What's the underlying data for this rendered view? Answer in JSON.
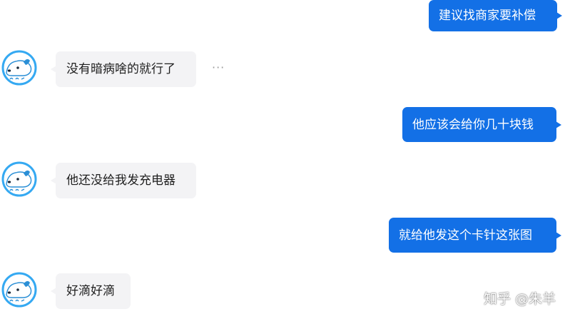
{
  "colors": {
    "outgoing_bubble": "#1370e6",
    "incoming_bubble": "#f3f3f5",
    "avatar_ring": "#35a9f2"
  },
  "messages": [
    {
      "side": "right",
      "text": "建议找商家要补偿"
    },
    {
      "side": "left",
      "text": "没有暗病啥的就行了"
    },
    {
      "side": "right",
      "text": "他应该会给你几十块钱"
    },
    {
      "side": "left",
      "text": "他还没给我发充电器"
    },
    {
      "side": "right",
      "text": "就给他发这个卡针这张图"
    },
    {
      "side": "left",
      "text": "好滴好滴"
    }
  ],
  "more_menu": {
    "label": "···",
    "icon": "more-horizontal-icon"
  },
  "avatar": {
    "icon": "dog-avatar-icon"
  },
  "watermark": {
    "text": "知乎 @朱羊"
  }
}
